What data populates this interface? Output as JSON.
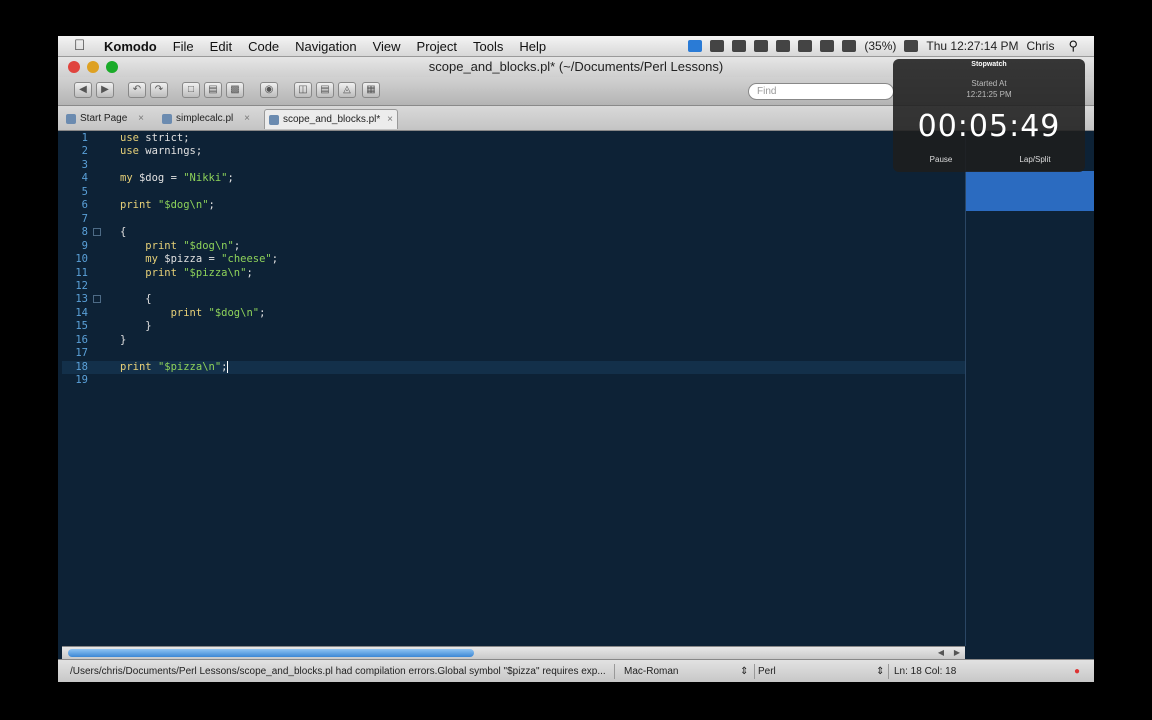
{
  "menubar": {
    "app": "Komodo",
    "items": [
      "File",
      "Edit",
      "Code",
      "Navigation",
      "View",
      "Project",
      "Tools",
      "Help"
    ],
    "battery": "(35%)",
    "clock": "Thu 12:27:14 PM",
    "user": "Chris"
  },
  "window": {
    "title": "scope_and_blocks.pl* (~/Documents/Perl Lessons)",
    "find_placeholder": "Find"
  },
  "tabs": [
    {
      "label": "Start Page"
    },
    {
      "label": "simplecalc.pl"
    },
    {
      "label": "scope_and_blocks.pl*"
    }
  ],
  "editor": {
    "lines": [
      {
        "n": "1",
        "parts": [
          [
            "kw",
            "use"
          ],
          [
            "",
            "strict;"
          ]
        ]
      },
      {
        "n": "2",
        "parts": [
          [
            "kw",
            "use"
          ],
          [
            "",
            "warnings;"
          ]
        ]
      },
      {
        "n": "3",
        "parts": []
      },
      {
        "n": "4",
        "parts": [
          [
            "kw",
            "my"
          ],
          [
            "",
            "$dog = "
          ],
          [
            "str",
            "\"Nikki\""
          ],
          [
            "",
            ";"
          ]
        ]
      },
      {
        "n": "5",
        "parts": []
      },
      {
        "n": "6",
        "parts": [
          [
            "kw",
            "print"
          ],
          [
            "",
            ""
          ],
          [
            "str",
            "\"$dog\\n\""
          ],
          [
            "",
            ";"
          ]
        ]
      },
      {
        "n": "7",
        "parts": []
      },
      {
        "n": "8",
        "parts": [
          [
            "",
            "{"
          ]
        ]
      },
      {
        "n": "9",
        "parts": [
          [
            "",
            "    "
          ],
          [
            "kw",
            "print"
          ],
          [
            "",
            ""
          ],
          [
            "str",
            "\"$dog\\n\""
          ],
          [
            "",
            ";"
          ]
        ]
      },
      {
        "n": "10",
        "parts": [
          [
            "",
            "    "
          ],
          [
            "kw",
            "my"
          ],
          [
            "",
            "$pizza = "
          ],
          [
            "str",
            "\"cheese\""
          ],
          [
            "",
            ";"
          ]
        ]
      },
      {
        "n": "11",
        "parts": [
          [
            "",
            "    "
          ],
          [
            "kw",
            "print"
          ],
          [
            "",
            ""
          ],
          [
            "str",
            "\"$pizza\\n\""
          ],
          [
            "",
            ";"
          ]
        ]
      },
      {
        "n": "12",
        "parts": []
      },
      {
        "n": "13",
        "parts": [
          [
            "",
            "    {"
          ]
        ]
      },
      {
        "n": "14",
        "parts": [
          [
            "",
            "        "
          ],
          [
            "kw",
            "print"
          ],
          [
            "",
            ""
          ],
          [
            "str",
            "\"$dog\\n\""
          ],
          [
            "",
            ";"
          ]
        ]
      },
      {
        "n": "15",
        "parts": [
          [
            "",
            "    }"
          ]
        ]
      },
      {
        "n": "16",
        "parts": [
          [
            "",
            "}"
          ]
        ]
      },
      {
        "n": "17",
        "parts": []
      },
      {
        "n": "18",
        "parts": [
          [
            "kw",
            "print"
          ],
          [
            "",
            ""
          ],
          [
            "str",
            "\"$pizza\\n\""
          ],
          [
            "",
            ";"
          ]
        ]
      },
      {
        "n": "19",
        "parts": []
      }
    ]
  },
  "statusbar": {
    "message": "/Users/chris/Documents/Perl Lessons/scope_and_blocks.pl had compilation errors.Global symbol \"$pizza\" requires exp...",
    "encoding": "Mac-Roman",
    "language": "Perl",
    "position": "Ln: 18 Col: 18"
  },
  "stopwatch": {
    "title": "Stopwatch",
    "started_label": "Started At",
    "started_time": "12:21:25 PM",
    "elapsed": "00:05:49",
    "pause_label": "Pause",
    "lap_label": "Lap/Split"
  }
}
